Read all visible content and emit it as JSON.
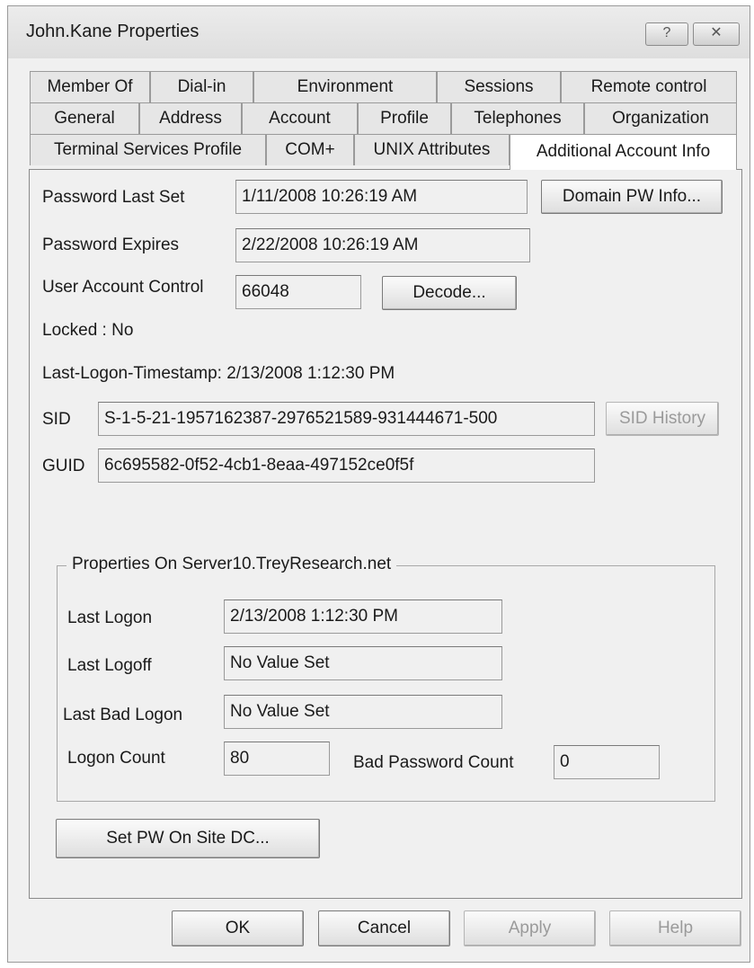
{
  "window": {
    "title": "John.Kane Properties",
    "help_label": "?",
    "close_label": "✕"
  },
  "tabs": {
    "row1": [
      "Member Of",
      "Dial-in",
      "Environment",
      "Sessions",
      "Remote control"
    ],
    "row2": [
      "General",
      "Address",
      "Account",
      "Profile",
      "Telephones",
      "Organization"
    ],
    "row3": [
      "Terminal Services Profile",
      "COM+",
      "UNIX Attributes",
      "Additional Account Info"
    ],
    "active": "Additional Account Info"
  },
  "account": {
    "pw_last_set_label": "Password Last Set",
    "pw_last_set_value": "1/11/2008 10:26:19 AM",
    "domain_pw_button": "Domain PW Info...",
    "pw_expires_label": "Password Expires",
    "pw_expires_value": "2/22/2008 10:26:19 AM",
    "uac_label": "User Account Control",
    "uac_value": "66048",
    "decode_button": "Decode...",
    "locked_text": "Locked : No",
    "last_logon_ts_text": "Last-Logon-Timestamp: 2/13/2008 1:12:30 PM",
    "sid_label": "SID",
    "sid_value": "S-1-5-21-1957162387-2976521589-931444671-500",
    "sid_history_button": "SID History",
    "guid_label": "GUID",
    "guid_value": "6c695582-0f52-4cb1-8eaa-497152ce0f5f"
  },
  "server_group": {
    "legend": "Properties On Server10.TreyResearch.net",
    "last_logon_label": "Last Logon",
    "last_logon_value": "2/13/2008 1:12:30 PM",
    "last_logoff_label": "Last Logoff",
    "last_logoff_value": "No Value Set",
    "last_bad_logon_label": "Last Bad Logon",
    "last_bad_logon_value": "No Value Set",
    "logon_count_label": "Logon Count",
    "logon_count_value": "80",
    "bad_pw_count_label": "Bad Password Count",
    "bad_pw_count_value": "0"
  },
  "set_pw_button": "Set PW On Site DC...",
  "footer": {
    "ok": "OK",
    "cancel": "Cancel",
    "apply": "Apply",
    "help": "Help"
  }
}
